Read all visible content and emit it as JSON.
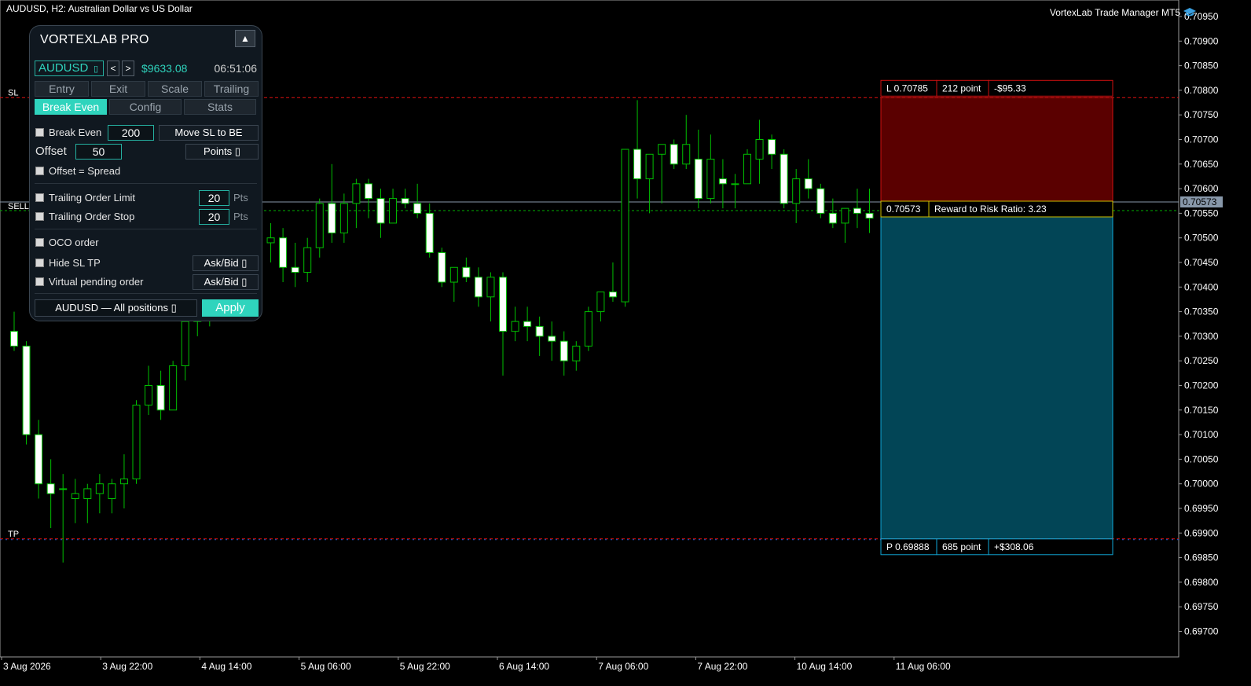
{
  "header": {
    "chart_title": "AUDUSD, H2:  Australian Dollar vs US Dollar",
    "brand": "VortexLab Trade Manager MT5"
  },
  "chart_data": {
    "type": "candlestick",
    "symbol": "AUDUSD",
    "timeframe": "H2",
    "ylim": [
      0.69675,
      0.70975
    ],
    "y_ticks": [
      "0.70950",
      "0.70900",
      "0.70850",
      "0.70800",
      "0.70750",
      "0.70700",
      "0.70650",
      "0.70600",
      "0.70550",
      "0.70500",
      "0.70450",
      "0.70400",
      "0.70350",
      "0.70300",
      "0.70250",
      "0.70200",
      "0.70150",
      "0.70100",
      "0.70050",
      "0.70000",
      "0.69950",
      "0.69900",
      "0.69850",
      "0.69800",
      "0.69750",
      "0.69700"
    ],
    "x_ticks": [
      "3 Aug 2026",
      "3 Aug 22:00",
      "4 Aug 14:00",
      "5 Aug 06:00",
      "5 Aug 22:00",
      "6 Aug 14:00",
      "7 Aug 06:00",
      "7 Aug 22:00",
      "10 Aug 14:00",
      "11 Aug 06:00"
    ],
    "current_price": "0.70573",
    "bull_color": "#00c000",
    "bear_color": "#ffffff",
    "candles": [
      [
        0.7031,
        0.7035,
        0.7027,
        0.7028
      ],
      [
        0.7028,
        0.7029,
        0.7008,
        0.701
      ],
      [
        0.701,
        0.7013,
        0.6997,
        0.7
      ],
      [
        0.7,
        0.7005,
        0.6991,
        0.6998
      ],
      [
        0.6999,
        0.7002,
        0.6984,
        0.6999
      ],
      [
        0.6997,
        0.7001,
        0.6992,
        0.6998
      ],
      [
        0.6997,
        0.7,
        0.6992,
        0.6999
      ],
      [
        0.6998,
        0.7002,
        0.6994,
        0.7
      ],
      [
        0.6997,
        0.7001,
        0.6994,
        0.7
      ],
      [
        0.7,
        0.7006,
        0.6995,
        0.7001
      ],
      [
        0.7001,
        0.7017,
        0.7,
        0.7016
      ],
      [
        0.7016,
        0.7024,
        0.7014,
        0.702
      ],
      [
        0.702,
        0.7023,
        0.7013,
        0.7015
      ],
      [
        0.7015,
        0.7025,
        0.7015,
        0.7024
      ],
      [
        0.7024,
        0.7035,
        0.7021,
        0.7033
      ],
      [
        0.7033,
        0.704,
        0.703,
        0.7036
      ],
      [
        0.7036,
        0.7045,
        0.7032,
        0.7041
      ],
      [
        0.7041,
        0.7052,
        0.7038,
        0.705
      ],
      [
        0.705,
        0.7054,
        0.7042,
        0.7044
      ],
      [
        0.7044,
        0.705,
        0.704,
        0.7048
      ],
      [
        0.7048,
        0.7052,
        0.7044,
        0.7049
      ],
      [
        0.7049,
        0.7053,
        0.7045,
        0.705
      ],
      [
        0.705,
        0.7052,
        0.7041,
        0.7044
      ],
      [
        0.7044,
        0.7049,
        0.704,
        0.7043
      ],
      [
        0.7043,
        0.705,
        0.7041,
        0.7048
      ],
      [
        0.7048,
        0.7058,
        0.7046,
        0.7057
      ],
      [
        0.7057,
        0.7065,
        0.7049,
        0.7051
      ],
      [
        0.7051,
        0.7059,
        0.7049,
        0.7057
      ],
      [
        0.7057,
        0.7062,
        0.7052,
        0.7061
      ],
      [
        0.7061,
        0.7062,
        0.7054,
        0.7058
      ],
      [
        0.7058,
        0.706,
        0.705,
        0.7053
      ],
      [
        0.7053,
        0.706,
        0.7053,
        0.7058
      ],
      [
        0.7058,
        0.706,
        0.7056,
        0.7057
      ],
      [
        0.7057,
        0.7061,
        0.7054,
        0.7055
      ],
      [
        0.7055,
        0.7057,
        0.7046,
        0.7047
      ],
      [
        0.7047,
        0.7048,
        0.704,
        0.7041
      ],
      [
        0.7041,
        0.7044,
        0.7037,
        0.7044
      ],
      [
        0.7044,
        0.7046,
        0.7041,
        0.7042
      ],
      [
        0.7042,
        0.7044,
        0.7036,
        0.7038
      ],
      [
        0.7038,
        0.7043,
        0.7033,
        0.7042
      ],
      [
        0.7042,
        0.7043,
        0.7022,
        0.7031
      ],
      [
        0.7031,
        0.7036,
        0.7029,
        0.7033
      ],
      [
        0.7033,
        0.7036,
        0.7029,
        0.7032
      ],
      [
        0.7032,
        0.7034,
        0.7026,
        0.703
      ],
      [
        0.703,
        0.7033,
        0.7025,
        0.7029
      ],
      [
        0.7029,
        0.7031,
        0.7022,
        0.7025
      ],
      [
        0.7025,
        0.7029,
        0.7023,
        0.7028
      ],
      [
        0.7028,
        0.7036,
        0.7027,
        0.7035
      ],
      [
        0.7035,
        0.7039,
        0.7033,
        0.7039
      ],
      [
        0.7039,
        0.7045,
        0.7037,
        0.7038
      ],
      [
        0.7037,
        0.7068,
        0.7036,
        0.7068
      ],
      [
        0.7068,
        0.7078,
        0.7058,
        0.7062
      ],
      [
        0.7062,
        0.7067,
        0.7055,
        0.7067
      ],
      [
        0.7067,
        0.7069,
        0.7057,
        0.7069
      ],
      [
        0.7069,
        0.707,
        0.7064,
        0.7065
      ],
      [
        0.7065,
        0.7075,
        0.7064,
        0.7069
      ],
      [
        0.7066,
        0.7072,
        0.7056,
        0.7058
      ],
      [
        0.7058,
        0.7071,
        0.7057,
        0.7066
      ],
      [
        0.7062,
        0.7066,
        0.7056,
        0.7061
      ],
      [
        0.7061,
        0.7063,
        0.7056,
        0.7061
      ],
      [
        0.7061,
        0.7068,
        0.7061,
        0.7067
      ],
      [
        0.7066,
        0.7074,
        0.7061,
        0.707
      ],
      [
        0.707,
        0.7071,
        0.7064,
        0.7067
      ],
      [
        0.7067,
        0.7068,
        0.7056,
        0.7057
      ],
      [
        0.7057,
        0.7064,
        0.7053,
        0.7062
      ],
      [
        0.7062,
        0.7066,
        0.7058,
        0.706
      ],
      [
        0.706,
        0.7061,
        0.7054,
        0.7055
      ],
      [
        0.7055,
        0.7058,
        0.7052,
        0.7053
      ],
      [
        0.7053,
        0.7056,
        0.7049,
        0.7056
      ],
      [
        0.7056,
        0.706,
        0.7052,
        0.7055
      ],
      [
        0.7055,
        0.706,
        0.7051,
        0.7054
      ]
    ],
    "trade": {
      "side_label": "SELL",
      "sl_label": "SL",
      "tp_label": "TP",
      "entry_price": 0.70573,
      "sl_price": 0.70785,
      "tp_price": 0.69888,
      "sl_box": [
        "L 0.70785",
        "212 point",
        "-$95.33"
      ],
      "entry_box": [
        "0.70573",
        "Reward to Risk Ratio:  3.23"
      ],
      "tp_box": [
        "P 0.69888",
        "685 point",
        "+$308.06"
      ],
      "risk_color": "#5a0000",
      "reward_color": "#024556"
    }
  },
  "panel": {
    "title": "VORTEXLAB PRO",
    "collapse_icon": "▲",
    "symbol": "AUDUSD",
    "symbol_drop": "▯",
    "prev": "<",
    "next": ">",
    "balance": "$9633.08",
    "time": "06:51:06",
    "tabs_row1": [
      "Entry",
      "Exit",
      "Scale",
      "Trailing"
    ],
    "tabs_row2": [
      "Break Even",
      "Config",
      "Stats"
    ],
    "break_even_label": "Break Even",
    "break_even_value": "200",
    "move_sl_button": "Move SL to BE",
    "offset_label": "Offset",
    "offset_value": "50",
    "points_select": "Points  ▯",
    "offset_spread_label": "Offset = Spread",
    "trailing_limit_label": "Trailing Order Limit",
    "trailing_limit_value": "20",
    "trailing_stop_label": "Trailing Order Stop",
    "trailing_stop_value": "20",
    "pts_unit": "Pts",
    "oco_label": "OCO order",
    "hide_sltp_label": "Hide SL TP",
    "askbid_1": "Ask/Bid ▯",
    "virtual_pending_label": "Virtual pending order",
    "askbid_2": "Ask/Bid ▯",
    "positions_select": "AUDUSD — All positions  ▯",
    "apply_button": "Apply"
  }
}
